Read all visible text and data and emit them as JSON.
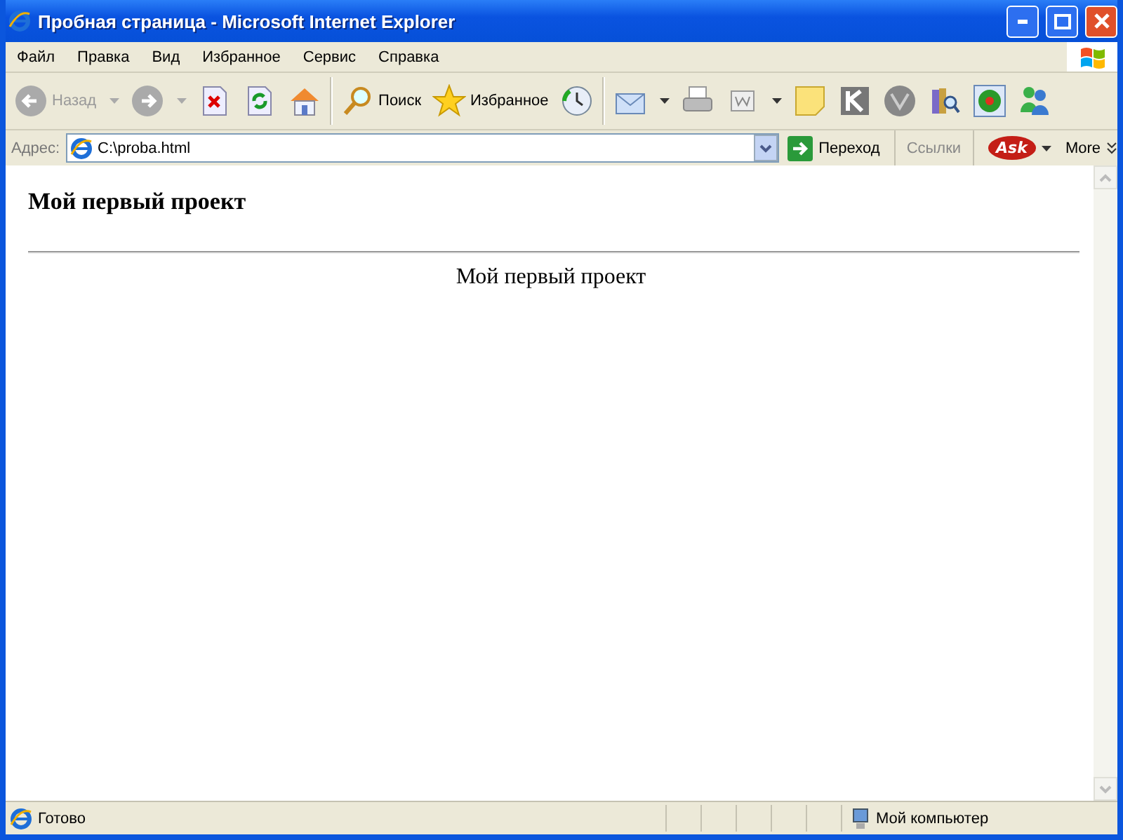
{
  "window": {
    "title": "Пробная страница - Microsoft Internet Explorer"
  },
  "menu": [
    "Файл",
    "Правка",
    "Вид",
    "Избранное",
    "Сервис",
    "Справка"
  ],
  "toolbar": [
    {
      "kind": "button",
      "label": "Назад",
      "disabled": true,
      "dropdown": true
    },
    {
      "kind": "button",
      "disabled": true,
      "dropdown": true
    },
    {
      "kind": "button"
    },
    {
      "kind": "button"
    },
    {
      "kind": "button"
    },
    {
      "kind": "separator"
    },
    {
      "kind": "button",
      "label": "Поиск"
    },
    {
      "kind": "button",
      "label": "Избранное"
    },
    {
      "kind": "button"
    },
    {
      "kind": "separator"
    },
    {
      "kind": "button",
      "dropdown": true
    },
    {
      "kind": "button"
    },
    {
      "kind": "button",
      "dropdown": true
    },
    {
      "kind": "button"
    },
    {
      "kind": "button"
    },
    {
      "kind": "button"
    },
    {
      "kind": "button"
    },
    {
      "kind": "button"
    },
    {
      "kind": "button"
    }
  ],
  "address": {
    "label": "Адрес:",
    "value": "C:\\proba.html",
    "go": "Переход",
    "links": "Ссылки",
    "ask": "Ask",
    "more": "More"
  },
  "page": {
    "heading": "Мой первый проект",
    "text": "Мой первый проект"
  },
  "status_bar": {
    "text": "Готово",
    "zone": "Мой компьютер"
  }
}
